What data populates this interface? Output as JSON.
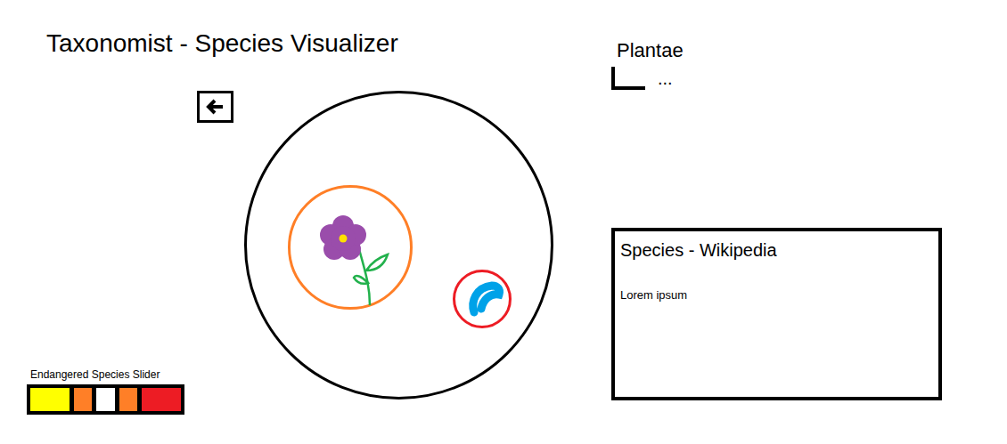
{
  "app": {
    "title": "Taxonomist - Species Visualizer"
  },
  "tree": {
    "root": "Plantae",
    "children": [
      "..."
    ]
  },
  "visualizer": {
    "nodes": [
      {
        "kind": "flower",
        "color": "#ff7f27"
      },
      {
        "kind": "crescent",
        "color": "#ed1c24"
      }
    ]
  },
  "info_panel": {
    "title": "Species - Wikipedia",
    "body": "Lorem ipsum"
  },
  "slider": {
    "label": "Endangered Species Slider",
    "segments": [
      {
        "kind": "end",
        "color": "#ffff00"
      },
      {
        "kind": "mid",
        "color": "#ff7f27"
      },
      {
        "kind": "thumb",
        "color": "#ffffff"
      },
      {
        "kind": "mid",
        "color": "#ff7f27"
      },
      {
        "kind": "end",
        "color": "#ed1c24"
      }
    ]
  }
}
